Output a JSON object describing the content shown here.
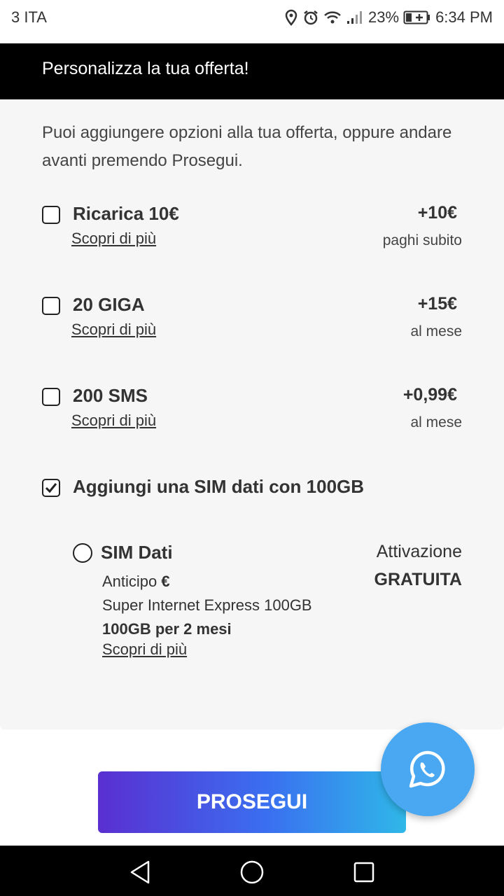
{
  "statusbar": {
    "carrier": "3 ITA",
    "battery": "23%",
    "time": "6:34 PM"
  },
  "header": {
    "title": "Personalizza la tua offerta!"
  },
  "intro": "Puoi aggiungere opzioni alla tua offerta, oppure andare avanti premendo Prosegui.",
  "options": [
    {
      "name": "Ricarica 10€",
      "link": "Scopri di più",
      "price": "+10€",
      "period": "paghi subito",
      "checked": false
    },
    {
      "name": "20 GIGA",
      "link": "Scopri di più",
      "price": "+15€",
      "period": "al mese",
      "checked": false
    },
    {
      "name": "200 SMS",
      "link": "Scopri di più",
      "price": "+0,99€",
      "period": "al mese",
      "checked": false
    }
  ],
  "sim_addon": {
    "label": "Aggiungi una SIM dati con 100GB",
    "checked": true
  },
  "sim": {
    "name": "SIM Dati",
    "anticipo_label": "Anticipo",
    "anticipo_value": "€",
    "plan": "Super Internet Express 100GB",
    "duration": "100GB per 2 mesi",
    "link": "Scopri di più",
    "activation": "Attivazione",
    "activation_price": "GRATUITA"
  },
  "cta": {
    "label": "PROSEGUI"
  },
  "colors": {
    "cta_start": "#5a2fd0",
    "cta_end": "#2fb8e8",
    "fab": "#4aa8f2",
    "header_bg": "#000000"
  },
  "icons": {
    "fab": "whatsapp-icon",
    "nav": [
      "back-icon",
      "home-icon",
      "recents-icon"
    ]
  }
}
